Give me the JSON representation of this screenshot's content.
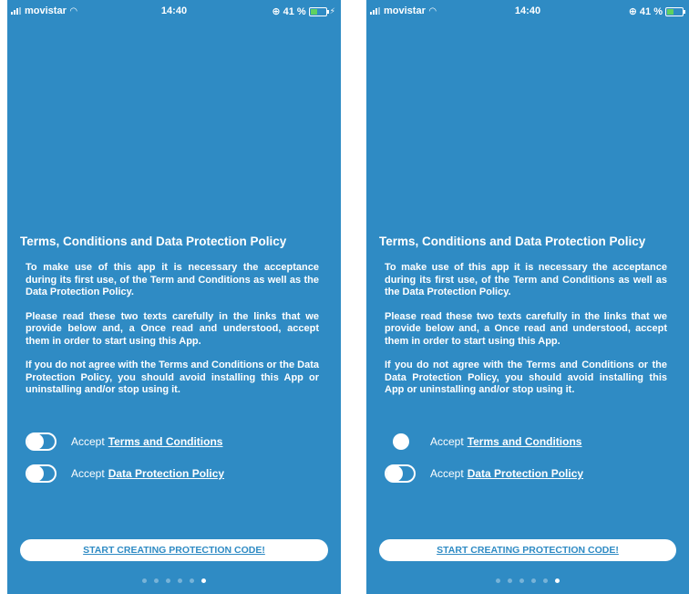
{
  "status_bar": {
    "carrier": "movistar",
    "time": "14:40",
    "battery_percent": "41 %",
    "battery_level": 0.41
  },
  "terms_screen": {
    "title": "Terms, Conditions and Data Protection Policy",
    "paragraphs": [
      "To make use of this app it is necessary the acceptance during its first use, of the Term and Conditions as well as the Data Protection Policy.",
      "Please read these two texts carefully in the links that we provide below and, a Once read and understood, accept them in order to start using this App.",
      "If you do not agree with the Terms and Conditions or the Data Protection Policy, you should avoid installing this App or uninstalling and/or stop using it."
    ],
    "accept_word": "Accept",
    "terms_link": "Terms and Conditions",
    "policy_link": "Data Protection Policy",
    "start_button": "START CREATING PROTECTION CODE!",
    "pagination": {
      "total": 6,
      "active_index": 5
    }
  },
  "colors": {
    "background": "#2f8bc4",
    "text": "#ffffff",
    "button_text": "#2f8bc4"
  }
}
